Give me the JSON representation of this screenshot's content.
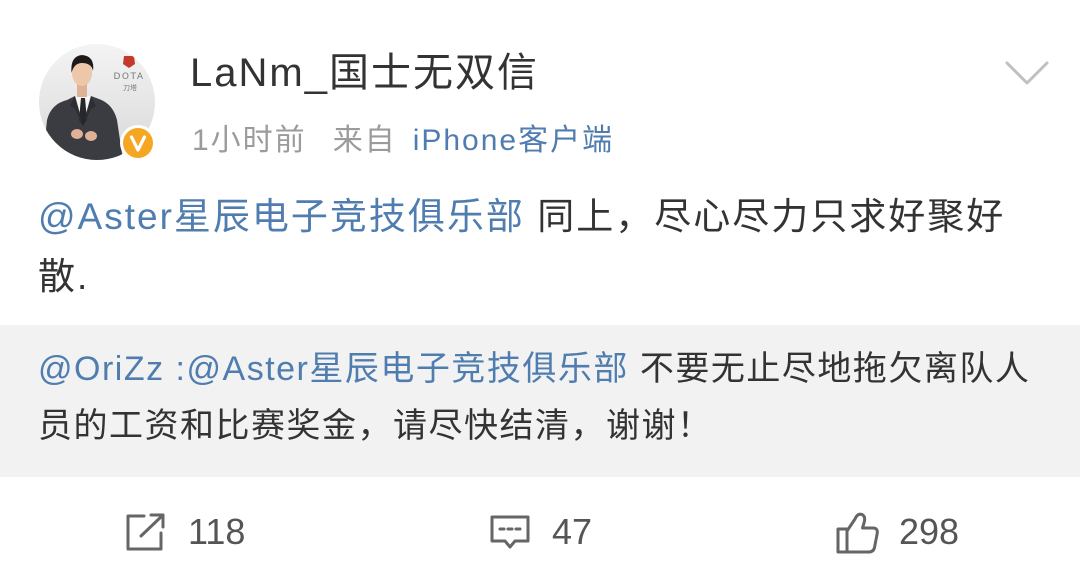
{
  "post": {
    "user": {
      "name": "LaNm_国士无双信",
      "avatar": {
        "logo_text": "DOTA",
        "logo_subtext": "刀塔",
        "verified_icon": "verified-badge-icon"
      }
    },
    "meta": {
      "time": "1小时前",
      "source_prefix": "来自",
      "source": "iPhone客户端"
    },
    "menu_icon": "chevron-down-icon",
    "body": {
      "mention": "@Aster星辰电子竞技俱乐部",
      "text": "同上，尽心尽力只求好聚好散."
    },
    "repost": {
      "author": "@OriZz :",
      "mention": "@Aster星辰电子竞技俱乐部",
      "text": "不要无止尽地拖欠离队人员的工资和比赛奖金，请尽快结清，谢谢！"
    },
    "actions": [
      {
        "icon": "repost-icon",
        "count": "118"
      },
      {
        "icon": "comment-icon",
        "count": "47"
      },
      {
        "icon": "like-icon",
        "count": "298"
      }
    ]
  },
  "colors": {
    "text": "#333333",
    "link": "#507daf",
    "meta": "#9b9b9b",
    "repost_bg": "#f2f2f2",
    "action": "#666666",
    "count": "#555555",
    "badge": "#f5a623",
    "chevron": "#c0c0c0"
  }
}
